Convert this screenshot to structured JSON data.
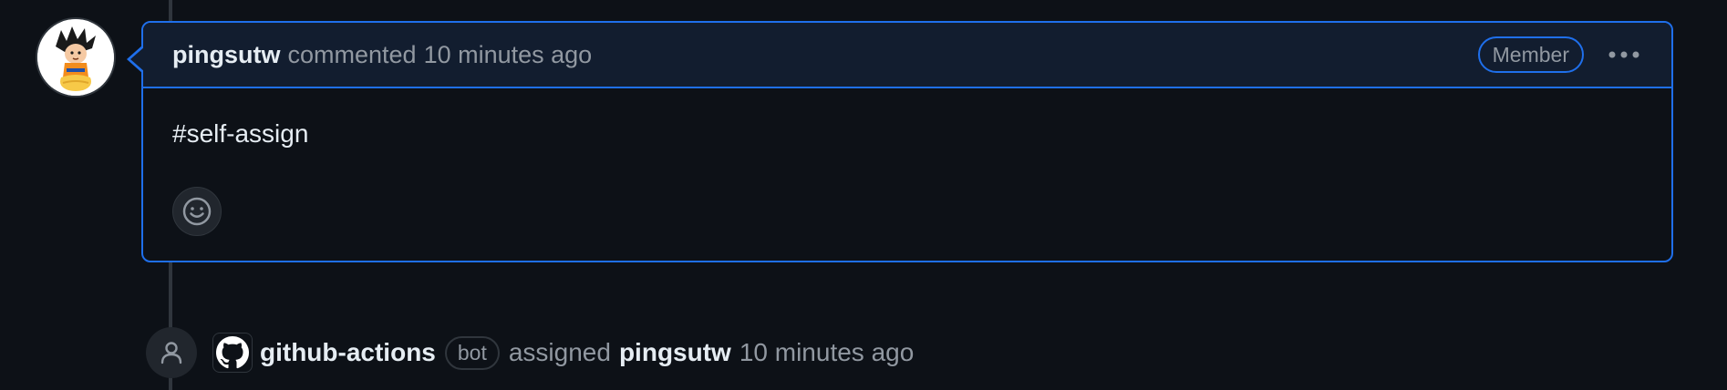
{
  "comment": {
    "author": "pingsutw",
    "action": "commented",
    "time": "10 minutes ago",
    "role_badge": "Member",
    "body": "#self-assign"
  },
  "event": {
    "actor": "github-actions",
    "actor_badge": "bot",
    "action": "assigned",
    "assignee": "pingsutw",
    "time": "10 minutes ago"
  },
  "icons": {
    "avatar": "user-avatar",
    "more": "kebab-horizontal-icon",
    "reaction": "smiley-icon",
    "event": "person-icon",
    "bot_avatar": "github-mark-icon"
  },
  "colors": {
    "background": "#0d1117",
    "accent_border": "#1f6feb",
    "header_bg": "#121d2f",
    "muted_text": "#9198a1"
  }
}
